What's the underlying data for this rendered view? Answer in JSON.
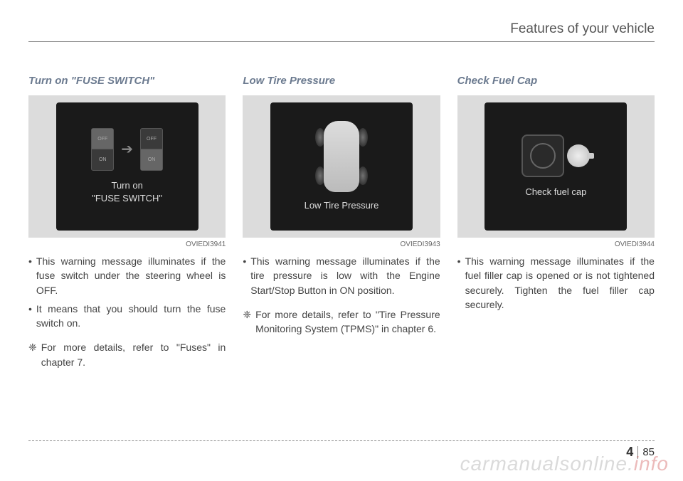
{
  "header": {
    "title": "Features of your vehicle"
  },
  "columns": [
    {
      "title": "Turn on \"FUSE SWITCH\"",
      "screen": {
        "line1": "Turn on",
        "line2": "\"FUSE SWITCH\"",
        "switch_off": "OFF",
        "switch_on": "ON"
      },
      "code": "OVIEDI3941",
      "bullets": [
        "This warning message illuminates if the fuse switch under the steering wheel is OFF.",
        "It means that you should turn the fuse switch on."
      ],
      "note": "For more details, refer to \"Fuses\" in chapter 7."
    },
    {
      "title": "Low Tire Pressure",
      "screen": {
        "line1": "Low Tire Pressure"
      },
      "code": "OVIEDI3943",
      "bullets": [
        "This warning message illuminates if the tire pressure is low with the Engine Start/Stop Button in ON position."
      ],
      "note": "For more details, refer to \"Tire Pressure Monitoring System (TPMS)\" in chapter 6."
    },
    {
      "title": "Check Fuel Cap",
      "screen": {
        "line1": "Check fuel cap"
      },
      "code": "OVIEDI3944",
      "bullets": [
        "This warning message illuminates if the fuel filler cap is opened or is not tightened securely. Tighten the fuel filler cap securely."
      ],
      "note": ""
    }
  ],
  "footer": {
    "chapter": "4",
    "page": "85"
  },
  "watermark": {
    "part1": "carmanualsonline.",
    "part2": "info"
  },
  "marks": {
    "bullet": "•",
    "note": "❈"
  }
}
